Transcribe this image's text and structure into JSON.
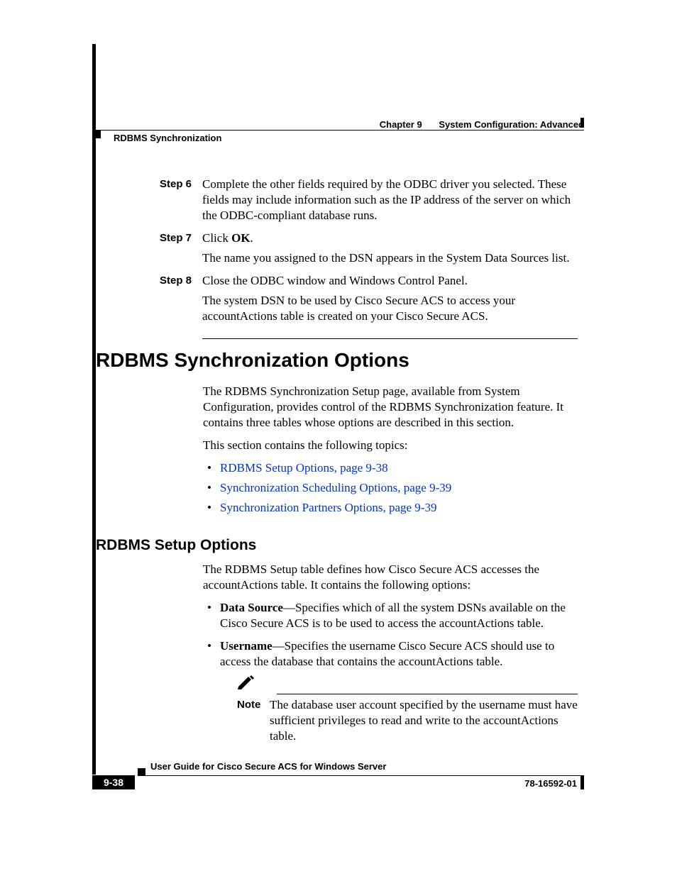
{
  "header": {
    "chapter": "Chapter 9",
    "chapter_title": "System Configuration: Advanced",
    "section": "RDBMS Synchronization"
  },
  "steps": [
    {
      "label": "Step 6",
      "paras": [
        "Complete the other fields required by the ODBC driver you selected. These fields may include information such as the IP address of the server on which the ODBC-compliant database runs."
      ]
    },
    {
      "label": "Step 7",
      "paras_html": [
        "Click <b>OK</b>.",
        "The name you assigned to the DSN appears in the System Data Sources list."
      ]
    },
    {
      "label": "Step 8",
      "paras": [
        "Close the ODBC window and Windows Control Panel.",
        "The system DSN to be used by Cisco Secure ACS to access your accountActions table is created on your Cisco Secure ACS."
      ]
    }
  ],
  "h1": "RDBMS Synchronization Options",
  "intro": [
    "The RDBMS Synchronization Setup page, available from System Configuration, provides control of the RDBMS Synchronization feature. It contains three tables whose options are described in this section.",
    "This section contains the following topics:"
  ],
  "toc": [
    "RDBMS Setup Options, page 9-38",
    "Synchronization Scheduling Options, page 9-39",
    "Synchronization Partners Options, page 9-39"
  ],
  "h2": "RDBMS Setup Options",
  "setup_intro": "The RDBMS Setup table defines how Cisco Secure ACS accesses the accountActions table. It contains the following options:",
  "options": [
    {
      "term": "Data Source",
      "desc": "—Specifies which of all the system DSNs available on the Cisco Secure ACS is to be used to access the accountActions table."
    },
    {
      "term": "Username",
      "desc": "—Specifies the username Cisco Secure ACS should use to access the database that contains the accountActions table."
    }
  ],
  "note": {
    "label": "Note",
    "text": "The database user account specified by the username must have sufficient privileges to read and write to the accountActions table."
  },
  "footer": {
    "title": "User Guide for Cisco Secure ACS for Windows Server",
    "page": "9-38",
    "doc": "78-16592-01"
  }
}
